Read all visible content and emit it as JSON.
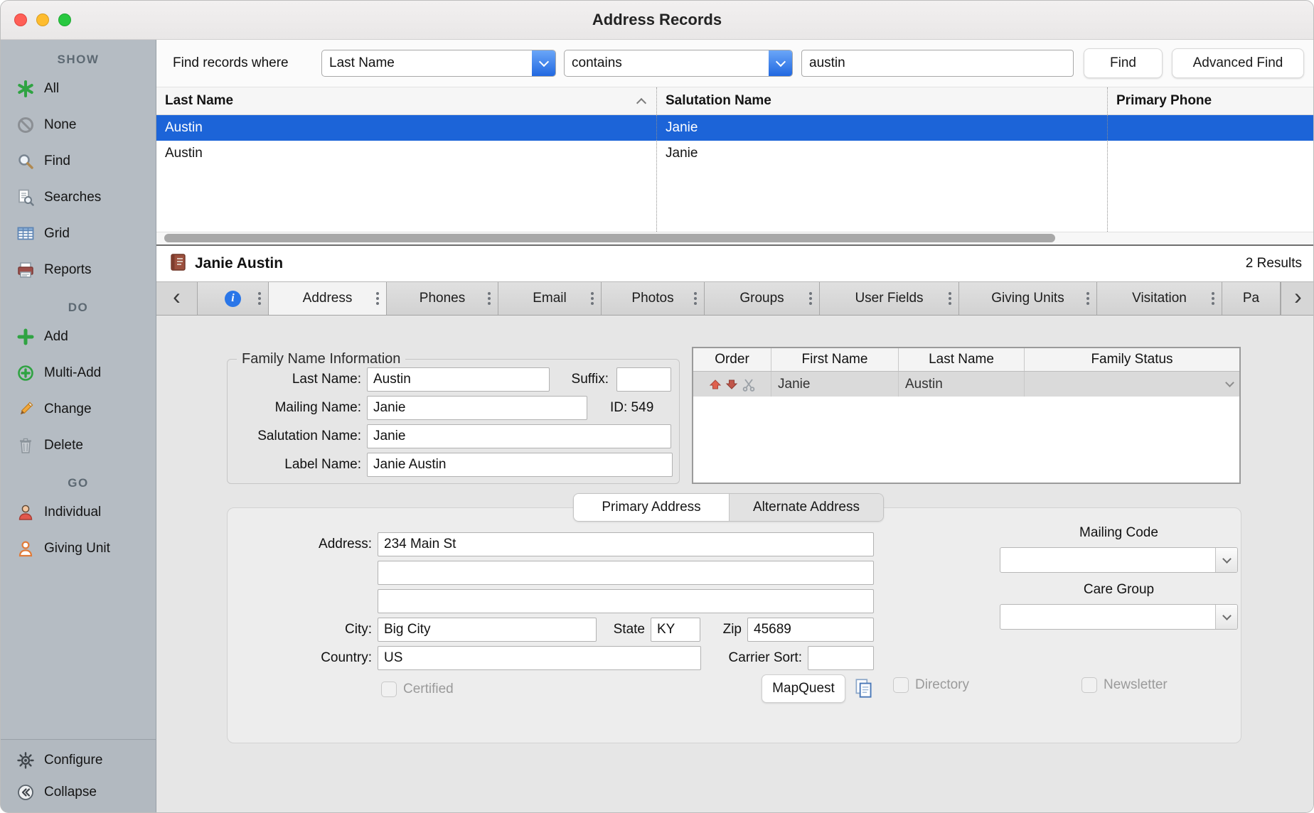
{
  "colors": {
    "selection_blue": "#1c64d8",
    "popup_accent_blue": "#2168e0",
    "sidebar_gray": "#b5bcc3",
    "content_gray": "#e6e6e6",
    "traffic_red": "#ff5f57",
    "traffic_yellow": "#febc2e",
    "traffic_green": "#28c840"
  },
  "window": {
    "title": "Address Records"
  },
  "sidebar": {
    "sections": [
      {
        "header": "SHOW",
        "items": [
          {
            "label": "All",
            "icon": "asterisk-icon"
          },
          {
            "label": "None",
            "icon": "no-circle-icon"
          },
          {
            "label": "Find",
            "icon": "magnifier-icon"
          },
          {
            "label": "Searches",
            "icon": "saved-search-icon"
          },
          {
            "label": "Grid",
            "icon": "grid-icon"
          },
          {
            "label": "Reports",
            "icon": "report-icon"
          }
        ]
      },
      {
        "header": "DO",
        "items": [
          {
            "label": "Add",
            "icon": "plus-icon"
          },
          {
            "label": "Multi-Add",
            "icon": "multi-add-icon"
          },
          {
            "label": "Change",
            "icon": "pencil-icon"
          },
          {
            "label": "Delete",
            "icon": "trash-icon"
          }
        ]
      },
      {
        "header": "GO",
        "items": [
          {
            "label": "Individual",
            "icon": "individual-person-icon"
          },
          {
            "label": "Giving Unit",
            "icon": "giving-unit-person-icon"
          }
        ]
      }
    ],
    "footer": [
      {
        "label": "Configure",
        "icon": "gear-icon"
      },
      {
        "label": "Collapse",
        "icon": "collapse-circle-icon"
      }
    ]
  },
  "find_bar": {
    "label": "Find records where",
    "field_dropdown_value": "Last Name",
    "operator_dropdown_value": "contains",
    "search_value": "austin",
    "find_button": "Find",
    "advanced_find_button": "Advanced Find"
  },
  "results_table": {
    "columns": [
      "Last Name",
      "Salutation Name",
      "Primary Phone"
    ],
    "sort_column": "Last Name",
    "rows": [
      {
        "last_name": "Austin",
        "salutation_name": "Janie",
        "primary_phone": "",
        "selected": true
      },
      {
        "last_name": "Austin",
        "salutation_name": "Janie",
        "primary_phone": "",
        "selected": false
      }
    ]
  },
  "record_header": {
    "name": "Janie Austin",
    "results_count": "2 Results"
  },
  "record_tabs": {
    "items": [
      "Address",
      "Phones",
      "Email",
      "Photos",
      "Groups",
      "User Fields",
      "Giving Units",
      "Visitation",
      "Pa"
    ],
    "active": "Address"
  },
  "family_info": {
    "group_title": "Family Name Information",
    "last_name_label": "Last Name:",
    "last_name": "Austin",
    "suffix_label": "Suffix:",
    "suffix": "",
    "mailing_name_label": "Mailing Name:",
    "mailing_name": "Janie",
    "id_text": "ID: 549",
    "salutation_name_label": "Salutation Name:",
    "salutation_name": "Janie",
    "label_name_label": "Label Name:",
    "label_name": "Janie Austin"
  },
  "family_members": {
    "columns": [
      "Order",
      "First Name",
      "Last Name",
      "Family Status"
    ],
    "rows": [
      {
        "first_name": "Janie",
        "last_name": "Austin",
        "family_status": ""
      }
    ]
  },
  "address_section": {
    "tabs": {
      "primary": "Primary Address",
      "alternate": "Alternate Address",
      "active": "Primary Address"
    },
    "address_label": "Address:",
    "address_line1": "234 Main St",
    "address_line2": "",
    "address_line3": "",
    "city_label": "City:",
    "city": "Big City",
    "state_label": "State",
    "state": "KY",
    "zip_label": "Zip",
    "zip": "45689",
    "country_label": "Country:",
    "country": "US",
    "carrier_sort_label": "Carrier Sort:",
    "carrier_sort": "",
    "certified_label": "Certified",
    "mapquest_button": "MapQuest",
    "mailing_code_label": "Mailing Code",
    "care_group_label": "Care Group",
    "directory_label": "Directory",
    "newsletter_label": "Newsletter"
  }
}
